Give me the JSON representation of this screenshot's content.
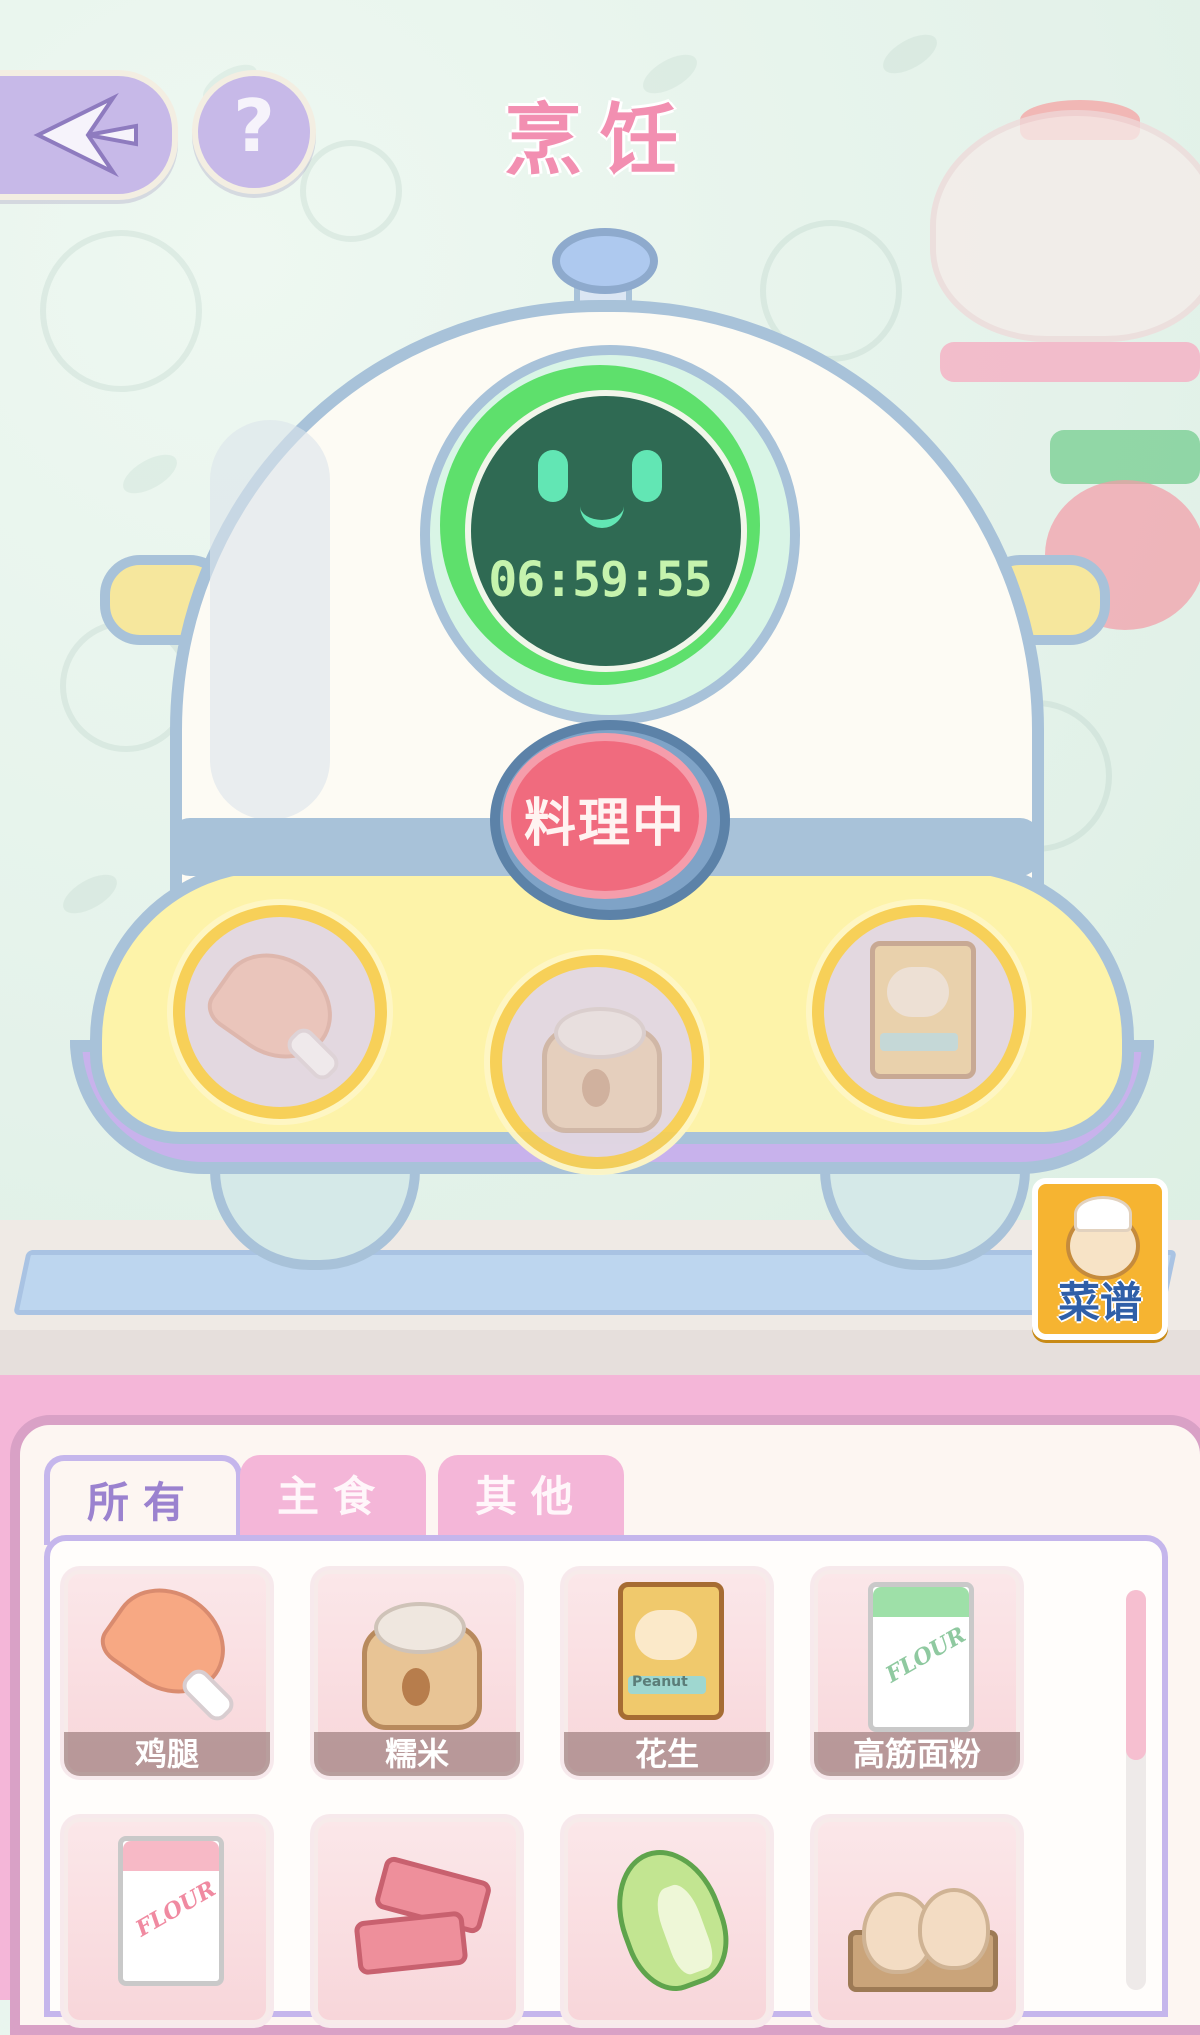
{
  "header": {
    "title": "烹饪"
  },
  "help_button": {
    "label": "?"
  },
  "cooker": {
    "timer": "06:59:55",
    "status_button": "料理中",
    "slots": [
      "鸡腿",
      "糯米",
      "花生"
    ]
  },
  "recipe_book": {
    "label": "菜谱"
  },
  "tabs": [
    {
      "label": "所有",
      "active": true
    },
    {
      "label": "主食",
      "active": false
    },
    {
      "label": "其他",
      "active": false
    }
  ],
  "ingredients": [
    {
      "name": "鸡腿",
      "icon": "drumstick-icon"
    },
    {
      "name": "糯米",
      "icon": "rice-sack-icon"
    },
    {
      "name": "花生",
      "icon": "peanut-bag-icon"
    },
    {
      "name": "高筋面粉",
      "icon": "flour-bag-green-icon"
    },
    {
      "name": "",
      "icon": "flour-bag-pink-icon"
    },
    {
      "name": "",
      "icon": "pork-belly-icon"
    },
    {
      "name": "",
      "icon": "cabbage-icon"
    },
    {
      "name": "",
      "icon": "egg-tray-icon"
    }
  ],
  "packaging_text": {
    "peanut": "Peanut",
    "flour": "FLOUR"
  },
  "colors": {
    "title": "#f28fb1",
    "active_tab_text": "#9b82cf",
    "inventory_bg": "#f4b6d8",
    "screen": "#2f6a53",
    "cook_button": "#f06b7e"
  }
}
